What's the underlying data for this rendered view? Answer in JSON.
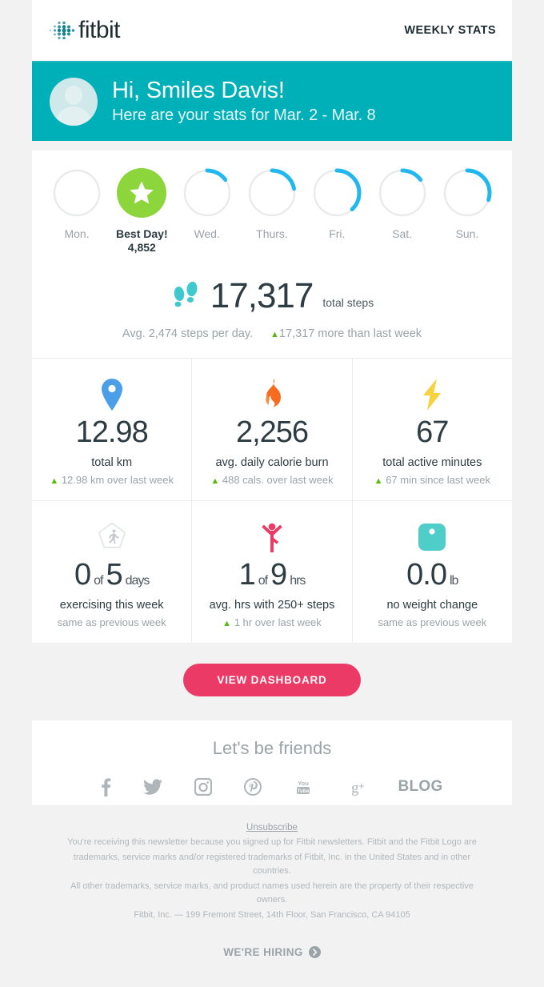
{
  "brand": {
    "name": "fitbit",
    "teal": "#00b0b9",
    "pink": "#ec3a66",
    "green": "#8cd63b",
    "blue": "#29a3f0"
  },
  "header": {
    "logo_text": "fitbit",
    "title": "WEEKLY STATS"
  },
  "banner": {
    "greeting": "Hi, Smiles Davis!",
    "subtitle": "Here are your stats for Mar. 2 - Mar. 8"
  },
  "days": [
    {
      "label": "Mon.",
      "percent": 0,
      "best": false
    },
    {
      "label": "Best Day!",
      "value": "4,852",
      "percent": 100,
      "best": true
    },
    {
      "label": "Wed.",
      "percent": 15,
      "best": false
    },
    {
      "label": "Thurs.",
      "percent": 22,
      "best": false
    },
    {
      "label": "Fri.",
      "percent": 38,
      "best": false
    },
    {
      "label": "Sat.",
      "percent": 15,
      "best": false
    },
    {
      "label": "Sun.",
      "percent": 30,
      "best": false
    }
  ],
  "steps": {
    "icon": "footprints-icon",
    "total": "17,317",
    "unit": "total steps",
    "average": "Avg. 2,474 steps per day.",
    "comparison": "17,317 more than last week"
  },
  "stats": [
    {
      "icon": "map-pin-icon",
      "value": "12.98",
      "label": "total km",
      "delta": "12.98 km over last week",
      "has_delta_arrow": true
    },
    {
      "icon": "flame-icon",
      "value": "2,256",
      "label": "avg. daily calorie burn",
      "delta": "488 cals. over last week",
      "has_delta_arrow": true
    },
    {
      "icon": "lightning-bolt-icon",
      "value": "67",
      "label": "total active minutes",
      "delta": "67 min since last week",
      "has_delta_arrow": true
    },
    {
      "icon": "exercise-shield-icon",
      "value": "0",
      "connector": "of",
      "value2": "5",
      "unit": "days",
      "label": "exercising this week",
      "delta": "same as previous week",
      "has_delta_arrow": false
    },
    {
      "icon": "active-person-icon",
      "value": "1",
      "connector": "of",
      "value2": "9",
      "unit": "hrs",
      "label": "avg. hrs with 250+ steps",
      "delta": "1 hr over last week",
      "has_delta_arrow": true
    },
    {
      "icon": "scale-icon",
      "value": "0.0",
      "unit": "lb",
      "label": "no weight change",
      "delta": "same as previous week",
      "has_delta_arrow": false
    }
  ],
  "cta": {
    "label": "VIEW DASHBOARD"
  },
  "footer": {
    "friends_heading": "Let's be friends",
    "socials": [
      {
        "name": "facebook-icon",
        "label": "f"
      },
      {
        "name": "twitter-icon",
        "label": ""
      },
      {
        "name": "instagram-icon",
        "label": ""
      },
      {
        "name": "pinterest-icon",
        "label": ""
      },
      {
        "name": "youtube-icon",
        "label": ""
      },
      {
        "name": "googleplus-icon",
        "label": ""
      },
      {
        "name": "blog-link",
        "label": "BLOG"
      }
    ],
    "unsubscribe": "Unsubscribe",
    "legal_line1": "You're receiving this newsletter because you signed up for Fitbit newsletters. Fitbit and the Fitbit Logo are",
    "legal_line2": "trademarks, service marks and/or registered trademarks of Fitbit, Inc. in the United States and in other countries.",
    "legal_line3": "All other trademarks, service marks, and product names used herein are the property of their respective owners.",
    "legal_line4": "Fitbit, Inc. — 199 Fremont Street, 14th Floor, San Francisco, CA 94105",
    "hiring": "WE'RE HIRING"
  }
}
